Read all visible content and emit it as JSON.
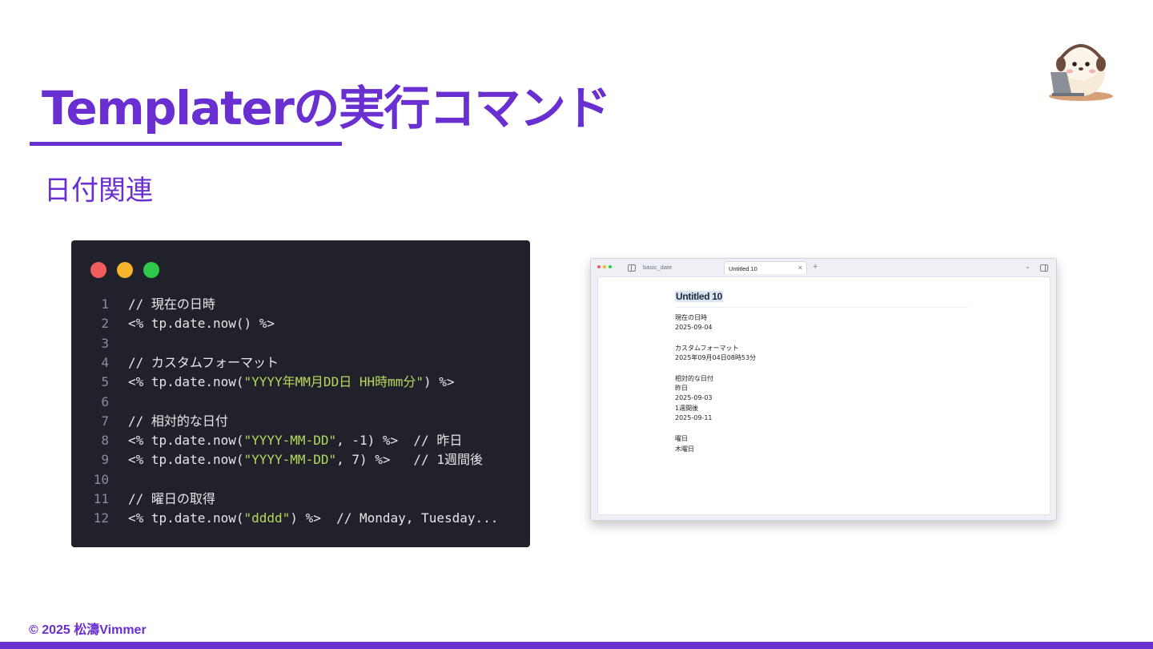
{
  "slide": {
    "title": "Templaterの実行コマンド",
    "subtitle": "日付関連",
    "footer": "© 2025 松濤Vimmer",
    "accent_color": "#6a2fd0"
  },
  "mascot": {
    "icon": "hamster-with-headphones-and-laptop-icon"
  },
  "code_window": {
    "dot_colors": [
      "#f15c5c",
      "#f6b52b",
      "#2ec94a"
    ],
    "lines": [
      {
        "number": "1",
        "parts": [
          {
            "text": "// 現在の日時",
            "kind": "plain"
          }
        ]
      },
      {
        "number": "2",
        "parts": [
          {
            "text": "<% tp.date.now() %>",
            "kind": "plain"
          }
        ]
      },
      {
        "number": "3",
        "parts": []
      },
      {
        "number": "4",
        "parts": [
          {
            "text": "// カスタムフォーマット",
            "kind": "plain"
          }
        ]
      },
      {
        "number": "5",
        "parts": [
          {
            "text": "<% tp.date.now(",
            "kind": "plain"
          },
          {
            "text": "\"YYYY年MM月DD日 HH時mm分\"",
            "kind": "string"
          },
          {
            "text": ") %>",
            "kind": "plain"
          }
        ]
      },
      {
        "number": "6",
        "parts": []
      },
      {
        "number": "7",
        "parts": [
          {
            "text": "// 相対的な日付",
            "kind": "plain"
          }
        ]
      },
      {
        "number": "8",
        "parts": [
          {
            "text": "<% tp.date.now(",
            "kind": "plain"
          },
          {
            "text": "\"YYYY-MM-DD\"",
            "kind": "string"
          },
          {
            "text": ", -1) %>  // 昨日",
            "kind": "plain"
          }
        ]
      },
      {
        "number": "9",
        "parts": [
          {
            "text": "<% tp.date.now(",
            "kind": "plain"
          },
          {
            "text": "\"YYYY-MM-DD\"",
            "kind": "string"
          },
          {
            "text": ", 7) %>   // 1週間後",
            "kind": "plain"
          }
        ]
      },
      {
        "number": "10",
        "parts": []
      },
      {
        "number": "11",
        "parts": [
          {
            "text": "// 曜日の取得",
            "kind": "plain"
          }
        ]
      },
      {
        "number": "12",
        "parts": [
          {
            "text": "<% tp.date.now(",
            "kind": "plain"
          },
          {
            "text": "\"dddd\"",
            "kind": "string"
          },
          {
            "text": ") %>  // Monday, Tuesday...",
            "kind": "plain"
          }
        ]
      }
    ]
  },
  "app": {
    "traffic_colors": [
      "#f15c5c",
      "#f6b52b",
      "#2ec94a"
    ],
    "inactive_tab": "basic_date",
    "active_tab": "Untitled 10",
    "close_glyph": "×",
    "new_tab_glyph": "+",
    "chevron_glyph": "⌄",
    "note_title": "Untitled 10",
    "note_lines": [
      "現在の日時",
      "2025-09-04",
      "",
      "カスタムフォーマット",
      "2025年09月04日08時53分",
      "",
      "相対的な日付",
      "昨日",
      "2025-09-03",
      "1週間後",
      "2025-09-11",
      "",
      "曜日",
      "木曜日"
    ]
  }
}
